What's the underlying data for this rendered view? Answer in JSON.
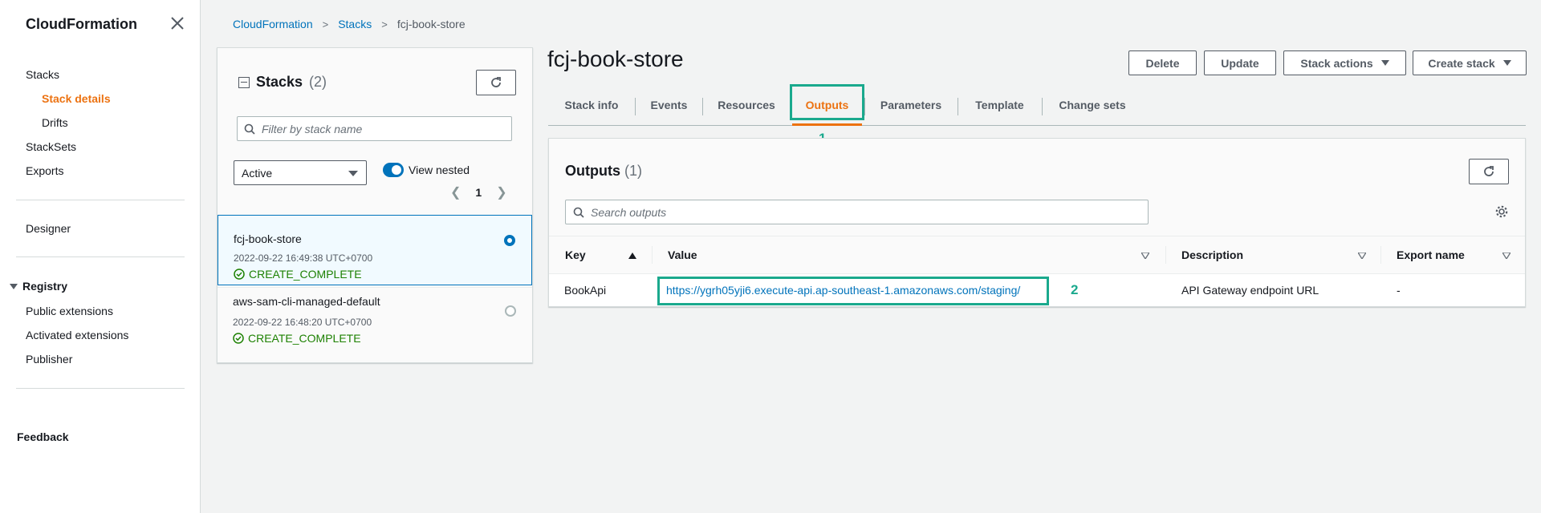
{
  "sidebar": {
    "title": "CloudFormation",
    "items": [
      {
        "label": "Stacks"
      },
      {
        "label": "Stack details"
      },
      {
        "label": "Drifts"
      },
      {
        "label": "StackSets"
      },
      {
        "label": "Exports"
      },
      {
        "label": "Designer"
      }
    ],
    "registry": {
      "label": "Registry",
      "items": [
        {
          "label": "Public extensions"
        },
        {
          "label": "Activated extensions"
        },
        {
          "label": "Publisher"
        }
      ]
    },
    "feedback": "Feedback"
  },
  "breadcrumb": {
    "items": [
      "CloudFormation",
      "Stacks"
    ],
    "current": "fcj-book-store",
    "separator": ">"
  },
  "stacks_panel": {
    "title": "Stacks",
    "count": "(2)",
    "filter_placeholder": "Filter by stack name",
    "status_filter": "Active",
    "view_nested_label": "View nested",
    "page": "1",
    "stacks": [
      {
        "name": "fcj-book-store",
        "time": "2022-09-22 16:49:38 UTC+0700",
        "status": "CREATE_COMPLETE"
      },
      {
        "name": "aws-sam-cli-managed-default",
        "time": "2022-09-22 16:48:20 UTC+0700",
        "status": "CREATE_COMPLETE"
      }
    ]
  },
  "stack_detail": {
    "title": "fcj-book-store",
    "buttons": {
      "delete": "Delete",
      "update": "Update",
      "stack_actions": "Stack actions",
      "create_stack": "Create stack"
    },
    "tabs": [
      {
        "label": "Stack info"
      },
      {
        "label": "Events"
      },
      {
        "label": "Resources"
      },
      {
        "label": "Outputs"
      },
      {
        "label": "Parameters"
      },
      {
        "label": "Template"
      },
      {
        "label": "Change sets"
      }
    ],
    "active_tab": "Outputs"
  },
  "markers": [
    "1",
    "2"
  ],
  "outputs": {
    "title": "Outputs",
    "count": "(1)",
    "search_placeholder": "Search outputs",
    "columns": [
      "Key",
      "Value",
      "Description",
      "Export name"
    ],
    "rows": [
      {
        "key": "BookApi",
        "value": "https://ygrh05yji6.execute-api.ap-southeast-1.amazonaws.com/staging/",
        "description": "API Gateway endpoint URL",
        "export_name": "-"
      }
    ]
  },
  "colors": {
    "accent": "#ec7211",
    "link": "#0073bb",
    "success": "#1d8102",
    "highlight": "#1aa98d"
  }
}
